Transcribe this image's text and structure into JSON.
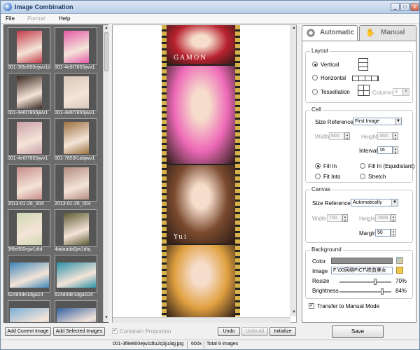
{
  "window": {
    "title": "Image Combination",
    "minimize": "_",
    "maximize": "□",
    "close": "x"
  },
  "menu": {
    "file": "File",
    "format": "Format",
    "help": "Help"
  },
  "thumbnails": [
    {
      "caption": "001-3f8e800ejwv1d",
      "color": "#c33c48",
      "wide": false
    },
    {
      "caption": "001-4e6f7855jwv1",
      "color": "#e45ca8",
      "wide": false
    },
    {
      "caption": "001-4e6f7855jwv1",
      "color": "#3a2a22",
      "wide": false
    },
    {
      "caption": "001-4e6f7855jwv1",
      "color": "#d9c8b8",
      "wide": false
    },
    {
      "caption": "001-4e6f7855jwv1",
      "color": "#c9a0a8",
      "wide": false
    },
    {
      "caption": "001-7853f1abjwv1",
      "color": "#9c7040",
      "wide": false
    },
    {
      "caption": "2013-01-26_004",
      "color": "#c78d8a",
      "wide": false
    },
    {
      "caption": "2013-01-26_004",
      "color": "#b48c80",
      "wide": false
    },
    {
      "caption": "3f8e800ejw1dtd",
      "color": "#cfd6b0",
      "wide": false
    },
    {
      "caption": "4adaada0jw1dtq",
      "color": "#5d5a32",
      "wide": false
    },
    {
      "caption": "624d4de1dga14",
      "color": "#3e86b8",
      "wide": true
    },
    {
      "caption": "624d4de1dga104",
      "color": "#2d92a8",
      "wide": true
    },
    {
      "caption": "",
      "color": "#7aaed6",
      "wide": true
    },
    {
      "caption": "",
      "color": "#3460a0",
      "wide": true
    }
  ],
  "preview": {
    "photos": [
      {
        "name": "roses",
        "color": "#b8222f",
        "overlay_text": "GAMON"
      },
      {
        "name": "pink-dress",
        "color": "#ee6ab8",
        "overlay_text": ""
      },
      {
        "name": "portrait",
        "color": "#7a4a2e",
        "overlay_text": "Yui"
      },
      {
        "name": "golden",
        "color": "#e0a040",
        "overlay_text": ""
      }
    ]
  },
  "tabs": {
    "automatic": "Automatic",
    "manual": "Manual"
  },
  "layout": {
    "title": "Layout",
    "vertical": "Vertical",
    "horizontal": "Horizontal",
    "tessellation": "Tessellation",
    "columns_label": "Columns",
    "columns_value": "3",
    "selected": "vertical"
  },
  "cell": {
    "title": "Cell",
    "size_reference_label": "Size Reference",
    "size_reference_value": "First Image",
    "width_label": "Width",
    "width_value": "600",
    "height_label": "Height",
    "height_value": "450",
    "interval_label": "Interval",
    "interval_value": "16",
    "fill_in": "Fill In",
    "fill_in_equidistant": "Fill In (Equidistant)",
    "fit_into": "Fit Into",
    "stretch": "Stretch",
    "selected": "fill_in"
  },
  "canvas": {
    "title": "Canvas",
    "size_reference_label": "Size Reference",
    "size_reference_value": "Automatically",
    "width_label": "Width",
    "width_value": "700",
    "height_label": "Height",
    "height_value": "7806",
    "margin_label": "Margin",
    "margin_value": "50"
  },
  "background": {
    "title": "Background",
    "color_label": "Color",
    "color_value": "#8c8c8c",
    "image_label": "Image",
    "image_value": "F:\\00网络PICT\\铁血美女",
    "resize_label": "Resize",
    "resize_value": "70%",
    "resize_fraction": 0.7,
    "brightness_label": "Brightness",
    "brightness_value": "84%",
    "brightness_fraction": 0.84
  },
  "transfer_to_manual": "Transfer to Manual Mode",
  "buttons": {
    "add_current": "Add Current Image",
    "add_selected": "Add Selected Images",
    "constrain": "Constrain Proportion",
    "undo": "Undo",
    "undo_all": "Undo All",
    "initialize": "Initialize",
    "save": "Save"
  },
  "status": {
    "file": "001-3f8e800ejw1dtu2q3ju3qj.jpg",
    "size": "600x",
    "total": "Total 9 images"
  }
}
